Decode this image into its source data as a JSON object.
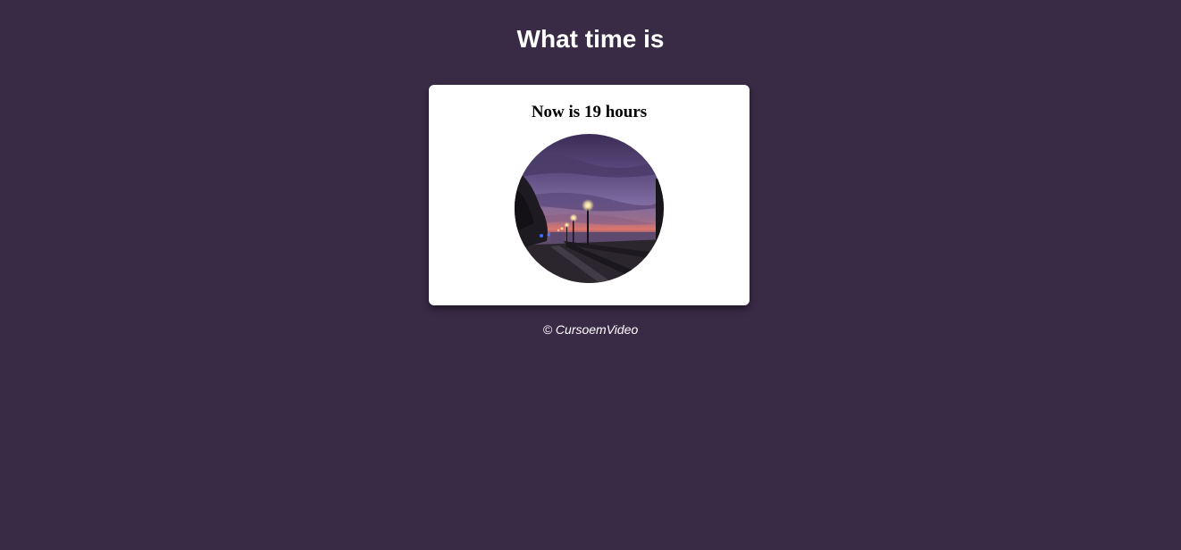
{
  "header": {
    "title": "What time is"
  },
  "card": {
    "message": "Now is 19 hours"
  },
  "footer": {
    "copyright": "© CursoemVideo"
  },
  "colors": {
    "background": "#392a46",
    "card": "#ffffff",
    "text_light": "#ffffff",
    "text_dark": "#000000"
  }
}
